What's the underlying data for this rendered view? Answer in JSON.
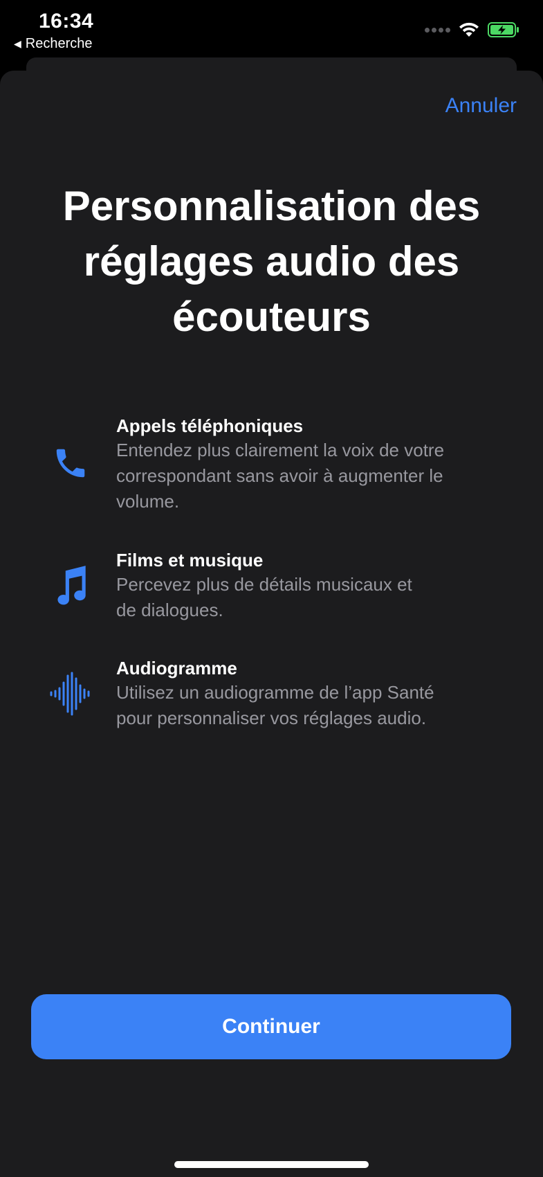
{
  "status_bar": {
    "time": "16:34",
    "back_app": "Recherche",
    "back_icon": "back-triangle-icon",
    "wifi_icon": "wifi-icon",
    "battery_icon": "battery-charging-icon",
    "battery_color": "#4cd964"
  },
  "sheet": {
    "cancel_label": "Annuler",
    "title": "Personnalisation des réglages audio des écouteurs",
    "features": [
      {
        "icon": "phone-icon",
        "title": "Appels téléphoniques",
        "description": "Entendez plus clairement la voix de votre\ncorrespondant sans avoir à augmenter le\nvolume."
      },
      {
        "icon": "music-note-icon",
        "title": "Films et musique",
        "description": "Percevez plus de détails musicaux et\nde dialogues."
      },
      {
        "icon": "waveform-icon",
        "title": "Audiogramme",
        "description": "Utilisez un audiogramme de l’app Santé\npour personnaliser vos réglages audio."
      }
    ],
    "continue_label": "Continuer"
  },
  "colors": {
    "accent": "#3b82f6",
    "sheet_background": "#1c1c1e",
    "secondary_text": "#98989f"
  }
}
